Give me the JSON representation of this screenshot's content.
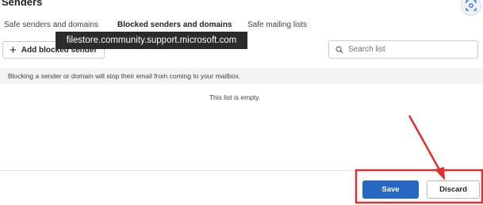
{
  "header": {
    "title": "Senders"
  },
  "tabs": [
    {
      "label": "Safe senders and domains",
      "active": false
    },
    {
      "label": "Blocked senders and domains",
      "active": true
    },
    {
      "label": "Safe mailing lists",
      "active": false
    }
  ],
  "tooltip": {
    "text": "filestore.community.support.microsoft.com"
  },
  "toolbar": {
    "add_label": "Add blocked sender"
  },
  "search": {
    "placeholder": "Search list",
    "value": ""
  },
  "info_banner": {
    "text": "Blocking a sender or domain will stop their email from coming to your mailbox."
  },
  "list": {
    "empty_text": "This list is empty."
  },
  "actions": {
    "save_label": "Save",
    "discard_label": "Discard"
  },
  "colors": {
    "accent": "#2567c1",
    "annotation": "#e03030"
  },
  "icons": {
    "add": "plus-icon",
    "search": "search-icon",
    "scan": "scan-icon"
  }
}
